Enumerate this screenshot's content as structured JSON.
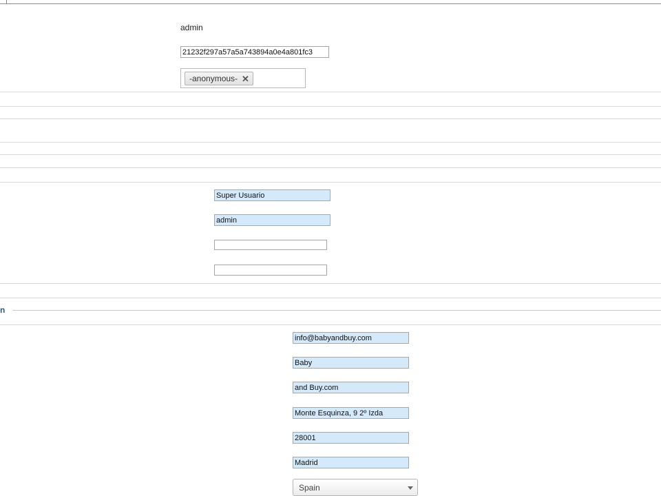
{
  "account": {
    "username": "admin",
    "password_hash": "21232f297a57a5a743894a0e4a801fc3",
    "roles": [
      {
        "label": "-anonymous-",
        "remove_symbol": "✕"
      }
    ]
  },
  "profile": {
    "full_name": "Super Usuario",
    "nickname": "admin",
    "field_three": "",
    "field_four": ""
  },
  "section": {
    "heading_fragment": "n"
  },
  "address": {
    "email": "info@babyandbuy.com",
    "first_name": "Baby",
    "last_name": "and Buy.com",
    "street": "Monte Esquinza, 9 2º Izda",
    "postal_code": "28001",
    "city": "Madrid",
    "country": "Spain"
  },
  "icons": {
    "tag_remove": "close-icon",
    "select_arrow": "chevron-down-icon"
  }
}
